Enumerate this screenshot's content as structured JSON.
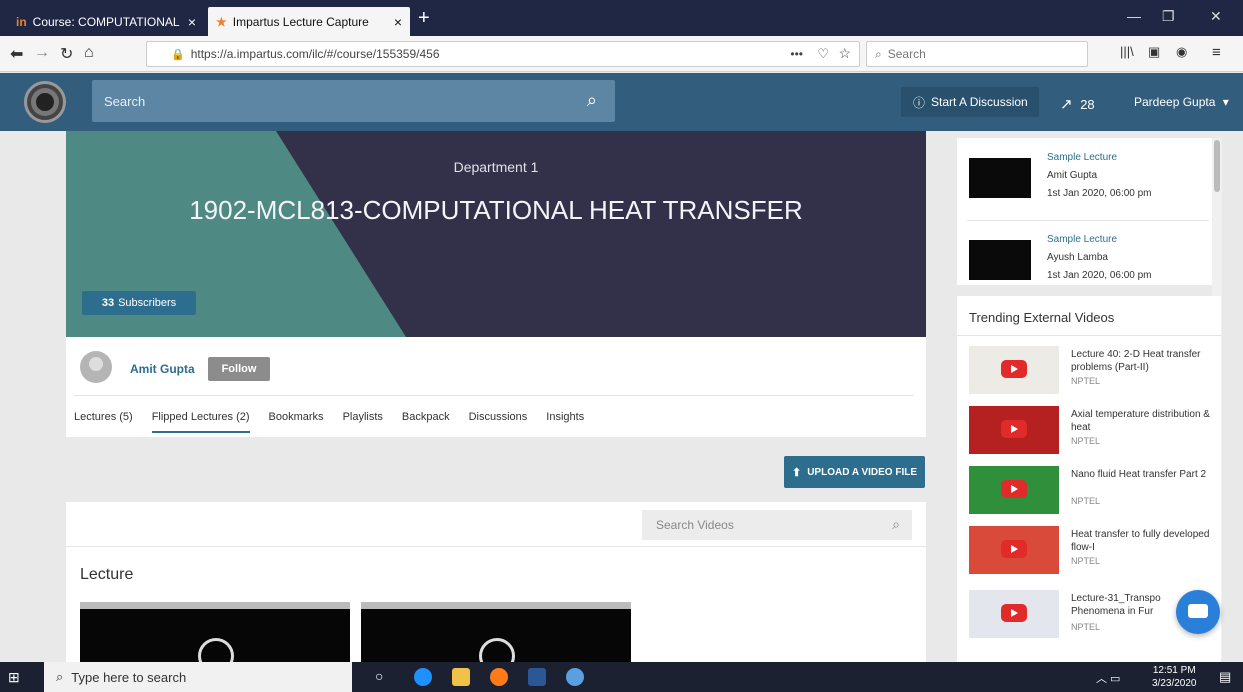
{
  "browser": {
    "tabs": [
      {
        "favicon": "in",
        "title": "Course: COMPUTATIONAL HE",
        "close": "×"
      },
      {
        "favicon": "★",
        "title": "Impartus Lecture Capture",
        "close": "×"
      }
    ],
    "new_tab": "+",
    "url": "https://a.impartus.com/ilc/#/course/155359/456",
    "search_placeholder": "Search",
    "menu_dots": "•••"
  },
  "header": {
    "search_placeholder": "Search",
    "start_discussion": "Start A Discussion",
    "trend_count": "28",
    "user_name": "Pardeep Gupta"
  },
  "course": {
    "department": "Department 1",
    "title": "1902-MCL813-COMPUTATIONAL HEAT TRANSFER",
    "subscribers_count": "33",
    "subscribers_label": "Subscribers",
    "instructor": "Amit Gupta",
    "follow_label": "Follow",
    "tabs": [
      "Lectures (5)",
      "Flipped Lectures (2)",
      "Bookmarks",
      "Playlists",
      "Backpack",
      "Discussions",
      "Insights"
    ],
    "active_tab": "Flipped Lectures (2)"
  },
  "videos": {
    "upload_label": "UPLOAD A VIDEO FILE",
    "search_placeholder": "Search Videos",
    "section_title": "Lecture"
  },
  "sidebar": {
    "lectures": [
      {
        "title": "Sample Lecture",
        "author": "Amit Gupta",
        "date": "1st Jan 2020, 06:00 pm"
      },
      {
        "title": "Sample Lecture",
        "author": "Ayush Lamba",
        "date": "1st Jan 2020, 06:00 pm"
      }
    ],
    "trending_title": "Trending External Videos",
    "trending": [
      {
        "title": "Lecture 40: 2-D Heat transfer problems (Part-II)",
        "source": "NPTEL"
      },
      {
        "title": "Axial temperature distribution & heat",
        "source": "NPTEL"
      },
      {
        "title": "Nano fluid Heat transfer Part 2",
        "source": "NPTEL"
      },
      {
        "title": "Heat transfer to fully developed flow-I",
        "source": "NPTEL"
      },
      {
        "title": "Lecture-31_Transpo Phenomena in Fur",
        "source": "NPTEL"
      }
    ]
  },
  "taskbar": {
    "search_placeholder": "Type here to search",
    "time": "12:51 PM",
    "date": "3/23/2020"
  },
  "colors": {
    "header": "#335d7c",
    "accent": "#2d6e8f",
    "banner_dark": "#323149",
    "banner_teal": "#4f8983"
  }
}
